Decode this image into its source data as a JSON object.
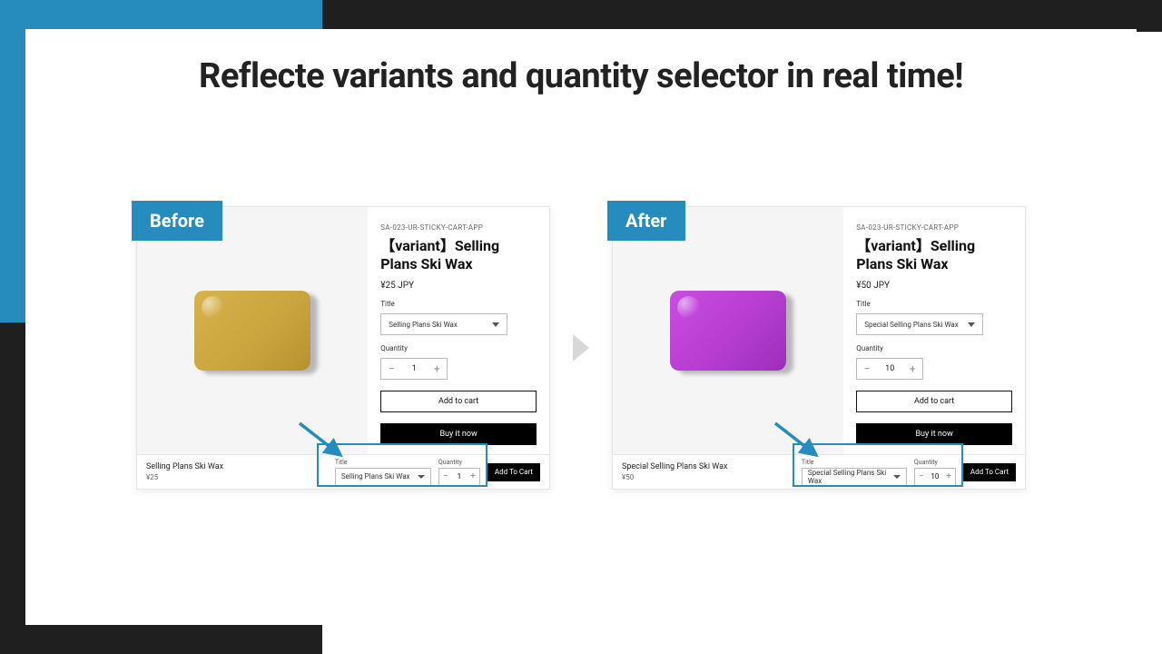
{
  "headline": "Reflecte variants and quantity selector in real time!",
  "badges": {
    "before": "Before",
    "after": "After"
  },
  "common": {
    "sku": "SA-023-UR-STICKY-CART-APP",
    "product_title": "【variant】Selling Plans Ski Wax",
    "title_label": "Title",
    "qty_label": "Quantity",
    "add_to_cart": "Add to cart",
    "buy_now": "Buy it now",
    "sticky_add": "Add To Cart",
    "minus": "−",
    "plus": "+"
  },
  "before": {
    "price": "¥25 JPY",
    "variant": "Selling Plans Ski Wax",
    "qty": "1",
    "sticky_name": "Selling Plans Ski Wax",
    "sticky_price": "¥25",
    "sticky_variant": "Selling Plans Ski Wax",
    "sticky_qty": "1"
  },
  "after": {
    "price": "¥50 JPY",
    "variant": "Special Selling Plans Ski Wax",
    "qty": "10",
    "sticky_name": "Special Selling Plans Ski Wax",
    "sticky_price": "¥50",
    "sticky_variant": "Special Selling Plans Ski Wax",
    "sticky_qty": "10"
  }
}
